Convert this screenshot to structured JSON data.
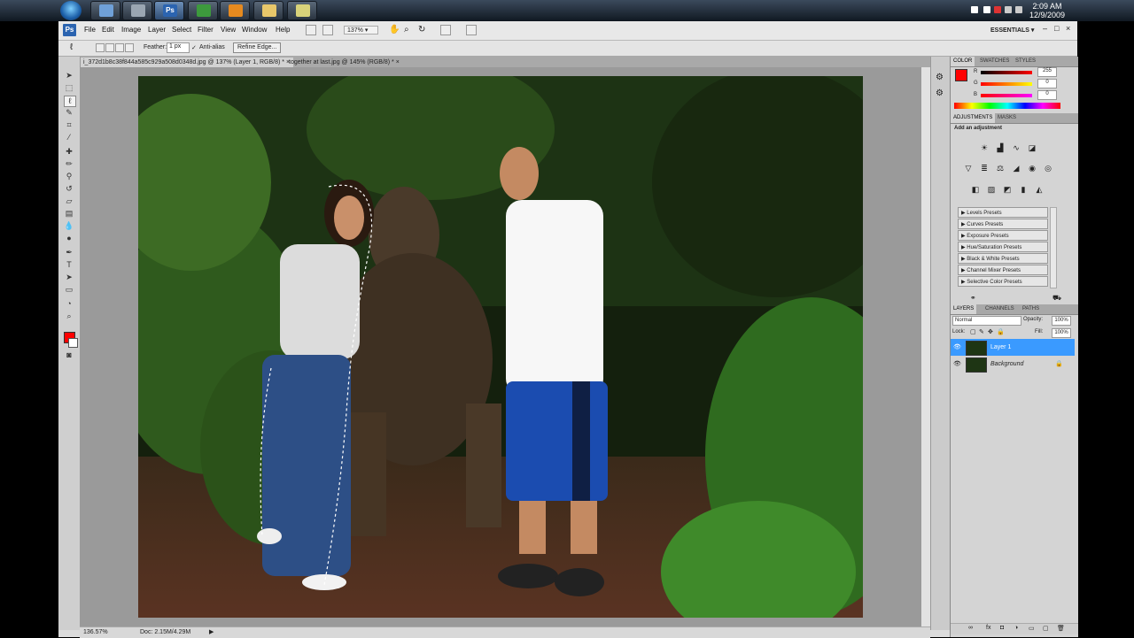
{
  "taskbar": {
    "clock_time": "2:09 AM",
    "clock_date": "12/9/2009",
    "buttons": [
      {
        "name": "start-orb"
      },
      {
        "name": "explorer-icon"
      },
      {
        "name": "calculator-icon"
      },
      {
        "name": "photoshop-icon"
      },
      {
        "name": "media-player-icon"
      },
      {
        "name": "video-player-icon"
      },
      {
        "name": "folder-icon"
      },
      {
        "name": "notes-icon"
      }
    ]
  },
  "app": {
    "logo": "Ps",
    "menus": [
      "File",
      "Edit",
      "Image",
      "Layer",
      "Select",
      "Filter",
      "View",
      "Window",
      "Help"
    ],
    "zoom_dropdown": "137%",
    "workspace": "ESSENTIALS",
    "options": {
      "feather_label": "Feather:",
      "feather_value": "1 px",
      "antialias_label": "Anti-alias",
      "refine_edge": "Refine Edge..."
    },
    "tabs": [
      {
        "label": "i_372d1b8c38f844a585c929a508d0348d.jpg @ 137% (Layer 1, RGB/8) *",
        "close": "×"
      },
      {
        "label": "together at last.jpg @ 145% (RGB/8) *",
        "close": "×"
      }
    ],
    "status": {
      "zoom": "136.57%",
      "doc": "Doc: 2.15M/4.29M"
    }
  },
  "panels": {
    "color": {
      "tabs": [
        "COLOR",
        "SWATCHES",
        "STYLES"
      ],
      "r_label": "R",
      "g_label": "G",
      "b_label": "B",
      "r_value": "255",
      "g_value": "0",
      "b_value": "0",
      "foreground_color": "#ff0000"
    },
    "adjustments": {
      "tabs": [
        "ADJUSTMENTS",
        "MASKS"
      ],
      "heading": "Add an adjustment",
      "presets": [
        "Levels Presets",
        "Curves Presets",
        "Exposure Presets",
        "Hue/Saturation Presets",
        "Black & White Presets",
        "Channel Mixer Presets",
        "Selective Color Presets"
      ]
    },
    "layers": {
      "tabs": [
        "LAYERS",
        "CHANNELS",
        "PATHS"
      ],
      "blend_mode": "Normal",
      "opacity_label": "Opacity:",
      "opacity_value": "100%",
      "lock_label": "Lock:",
      "fill_label": "Fill:",
      "fill_value": "100%",
      "rows": [
        {
          "name": "Layer 1",
          "selected": true
        },
        {
          "name": "Background",
          "selected": false
        }
      ]
    }
  }
}
